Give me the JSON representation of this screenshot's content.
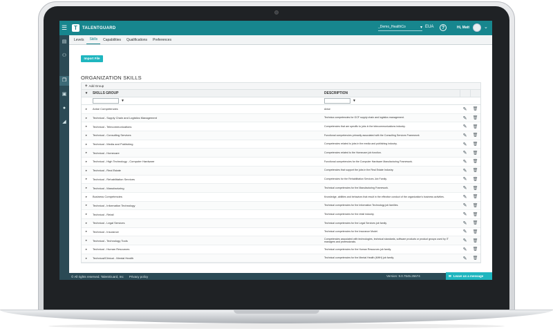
{
  "brand": {
    "name": "TALENTGUARD",
    "logo": "T"
  },
  "header": {
    "tenant": "_Demo_HealthCo",
    "language": "EUA",
    "greeting": "Hi, Matt",
    "help_label": "?"
  },
  "tabs": [
    "Levels",
    "Skills",
    "Capabilities",
    "Qualifications",
    "Preferences"
  ],
  "active_tab": "Skills",
  "import_button": "Import File",
  "section_title": "ORGANIZATION SKILLS",
  "add_group_label": "Add Group",
  "columns": {
    "group": "SKILLS GROUP",
    "description": "DESCRIPTION"
  },
  "rows": [
    {
      "group": "Anise Competencies",
      "description": "Anise"
    },
    {
      "group": "Technical - Supply Chain and Logistics Management",
      "description": "Technica competencies for GCF supply chain and logistics management."
    },
    {
      "group": "Technical - Telecommunications",
      "description": "Competencies that are specific to jobs in the telecommunications industry."
    },
    {
      "group": "Technical - Consulting Services",
      "description": "Functional competencies primarily associated with the Consulting Services Framework"
    },
    {
      "group": "Technical - Media and Publishing",
      "description": "Competencies related to jobs in the media and publishing industry."
    },
    {
      "group": "Technical - Homecare",
      "description": "Competencies related to the Homecare job function."
    },
    {
      "group": "Technical - High Technology - Computer Hardware",
      "description": "Functional competencies for the Computer Hardware Manufacturing Framework."
    },
    {
      "group": "Technical - Real Estate",
      "description": "Competencies that support the jobs in the Real Estate Industry."
    },
    {
      "group": "Technical - Rehabilitation Services",
      "description": "Competencies for the Rehabilitation Services Job Family."
    },
    {
      "group": "Technical - Manufacturing",
      "description": "Technical competencies for the Manufacturing Framework."
    },
    {
      "group": "Business Competencies",
      "description": "Knowledge, abilities and behaviors that result in the effective conduct of the organization's business activities."
    },
    {
      "group": "Technical - Information Technology",
      "description": "Technical competencies for the Information Technology job families."
    },
    {
      "group": "Technical - Retail",
      "description": "Technical competencies for the retail industry."
    },
    {
      "group": "Technical - Legal Services",
      "description": "Technical competencies for the Legal Services job family."
    },
    {
      "group": "Technical - Insurance",
      "description": "Technical competencies for the Insurance Model."
    },
    {
      "group": "Technical - Technology Tools",
      "description": "Competencies associated with technologies, technical standards, software products or product groups used by IT managers and professionals."
    },
    {
      "group": "Technical - Human Resources",
      "description": "Technical competencies for the Human Resources job family."
    },
    {
      "group": "Technical/Clinical - Mental Health",
      "description": "Technical competencies for the Mental Health (MHH) job family."
    }
  ],
  "footer": {
    "rights": "© All rights reserved. TalentGuard, Inc",
    "privacy": "Privacy policy",
    "version": "Version: 9.0.7545.25674"
  },
  "message_button": "Leave us a message",
  "colors": {
    "accent": "#17868e",
    "nav": "#2b4a55",
    "button": "#1fb6bf"
  }
}
